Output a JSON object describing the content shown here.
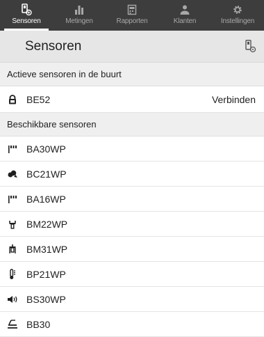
{
  "tabs": [
    {
      "label": "Sensoren",
      "icon": "sensor-device-icon",
      "active": true
    },
    {
      "label": "Metingen",
      "icon": "bar-chart-icon",
      "active": false
    },
    {
      "label": "Rapporten",
      "icon": "report-icon",
      "active": false
    },
    {
      "label": "Klanten",
      "icon": "users-icon",
      "active": false
    },
    {
      "label": "Instellingen",
      "icon": "gear-icon",
      "active": false
    }
  ],
  "header": {
    "title": "Sensoren",
    "action_icon": "sensor-settings-icon"
  },
  "active_section": {
    "label": "Actieve sensoren in de buurt",
    "items": [
      {
        "name": "BE52",
        "icon": "lock-icon",
        "action": "Verbinden"
      }
    ]
  },
  "available_section": {
    "label": "Beschikbare sensoren",
    "items": [
      {
        "name": "BA30WP",
        "icon": "bars-sensor-icon"
      },
      {
        "name": "BC21WP",
        "icon": "cloud-icon"
      },
      {
        "name": "BA16WP",
        "icon": "bars-sensor-icon"
      },
      {
        "name": "BM22WP",
        "icon": "probe-icon"
      },
      {
        "name": "BM31WP",
        "icon": "probe-pin-icon"
      },
      {
        "name": "BP21WP",
        "icon": "thermometer-icon"
      },
      {
        "name": "BS30WP",
        "icon": "speaker-icon"
      },
      {
        "name": "BB30",
        "icon": "level-icon"
      }
    ]
  },
  "colors": {
    "tabbar": "#3d3d3d",
    "titlebar": "#e6e6e6",
    "section": "#efefef"
  }
}
